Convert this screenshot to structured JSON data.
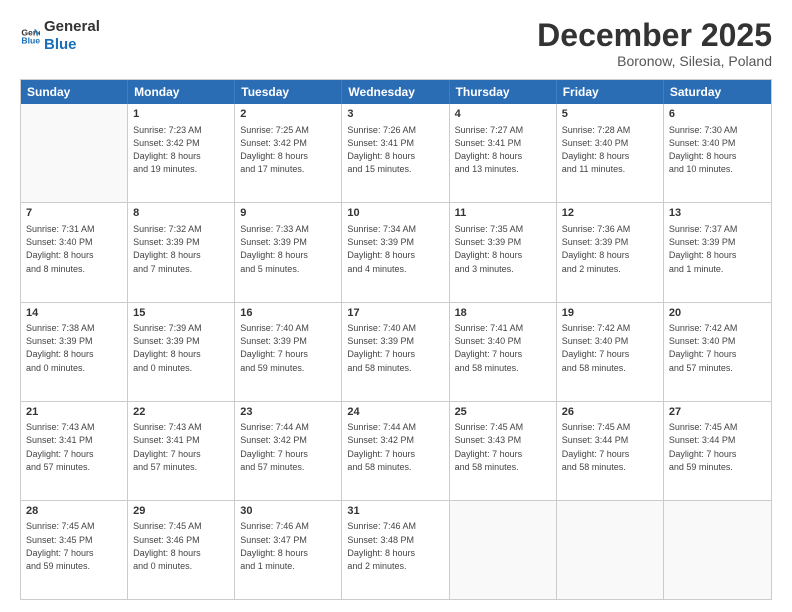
{
  "logo": {
    "line1": "General",
    "line2": "Blue"
  },
  "header": {
    "month": "December 2025",
    "location": "Boronow, Silesia, Poland"
  },
  "weekdays": [
    "Sunday",
    "Monday",
    "Tuesday",
    "Wednesday",
    "Thursday",
    "Friday",
    "Saturday"
  ],
  "weeks": [
    [
      {
        "day": "",
        "text": ""
      },
      {
        "day": "1",
        "text": "Sunrise: 7:23 AM\nSunset: 3:42 PM\nDaylight: 8 hours\nand 19 minutes."
      },
      {
        "day": "2",
        "text": "Sunrise: 7:25 AM\nSunset: 3:42 PM\nDaylight: 8 hours\nand 17 minutes."
      },
      {
        "day": "3",
        "text": "Sunrise: 7:26 AM\nSunset: 3:41 PM\nDaylight: 8 hours\nand 15 minutes."
      },
      {
        "day": "4",
        "text": "Sunrise: 7:27 AM\nSunset: 3:41 PM\nDaylight: 8 hours\nand 13 minutes."
      },
      {
        "day": "5",
        "text": "Sunrise: 7:28 AM\nSunset: 3:40 PM\nDaylight: 8 hours\nand 11 minutes."
      },
      {
        "day": "6",
        "text": "Sunrise: 7:30 AM\nSunset: 3:40 PM\nDaylight: 8 hours\nand 10 minutes."
      }
    ],
    [
      {
        "day": "7",
        "text": "Sunrise: 7:31 AM\nSunset: 3:40 PM\nDaylight: 8 hours\nand 8 minutes."
      },
      {
        "day": "8",
        "text": "Sunrise: 7:32 AM\nSunset: 3:39 PM\nDaylight: 8 hours\nand 7 minutes."
      },
      {
        "day": "9",
        "text": "Sunrise: 7:33 AM\nSunset: 3:39 PM\nDaylight: 8 hours\nand 5 minutes."
      },
      {
        "day": "10",
        "text": "Sunrise: 7:34 AM\nSunset: 3:39 PM\nDaylight: 8 hours\nand 4 minutes."
      },
      {
        "day": "11",
        "text": "Sunrise: 7:35 AM\nSunset: 3:39 PM\nDaylight: 8 hours\nand 3 minutes."
      },
      {
        "day": "12",
        "text": "Sunrise: 7:36 AM\nSunset: 3:39 PM\nDaylight: 8 hours\nand 2 minutes."
      },
      {
        "day": "13",
        "text": "Sunrise: 7:37 AM\nSunset: 3:39 PM\nDaylight: 8 hours\nand 1 minute."
      }
    ],
    [
      {
        "day": "14",
        "text": "Sunrise: 7:38 AM\nSunset: 3:39 PM\nDaylight: 8 hours\nand 0 minutes."
      },
      {
        "day": "15",
        "text": "Sunrise: 7:39 AM\nSunset: 3:39 PM\nDaylight: 8 hours\nand 0 minutes."
      },
      {
        "day": "16",
        "text": "Sunrise: 7:40 AM\nSunset: 3:39 PM\nDaylight: 7 hours\nand 59 minutes."
      },
      {
        "day": "17",
        "text": "Sunrise: 7:40 AM\nSunset: 3:39 PM\nDaylight: 7 hours\nand 58 minutes."
      },
      {
        "day": "18",
        "text": "Sunrise: 7:41 AM\nSunset: 3:40 PM\nDaylight: 7 hours\nand 58 minutes."
      },
      {
        "day": "19",
        "text": "Sunrise: 7:42 AM\nSunset: 3:40 PM\nDaylight: 7 hours\nand 58 minutes."
      },
      {
        "day": "20",
        "text": "Sunrise: 7:42 AM\nSunset: 3:40 PM\nDaylight: 7 hours\nand 57 minutes."
      }
    ],
    [
      {
        "day": "21",
        "text": "Sunrise: 7:43 AM\nSunset: 3:41 PM\nDaylight: 7 hours\nand 57 minutes."
      },
      {
        "day": "22",
        "text": "Sunrise: 7:43 AM\nSunset: 3:41 PM\nDaylight: 7 hours\nand 57 minutes."
      },
      {
        "day": "23",
        "text": "Sunrise: 7:44 AM\nSunset: 3:42 PM\nDaylight: 7 hours\nand 57 minutes."
      },
      {
        "day": "24",
        "text": "Sunrise: 7:44 AM\nSunset: 3:42 PM\nDaylight: 7 hours\nand 58 minutes."
      },
      {
        "day": "25",
        "text": "Sunrise: 7:45 AM\nSunset: 3:43 PM\nDaylight: 7 hours\nand 58 minutes."
      },
      {
        "day": "26",
        "text": "Sunrise: 7:45 AM\nSunset: 3:44 PM\nDaylight: 7 hours\nand 58 minutes."
      },
      {
        "day": "27",
        "text": "Sunrise: 7:45 AM\nSunset: 3:44 PM\nDaylight: 7 hours\nand 59 minutes."
      }
    ],
    [
      {
        "day": "28",
        "text": "Sunrise: 7:45 AM\nSunset: 3:45 PM\nDaylight: 7 hours\nand 59 minutes."
      },
      {
        "day": "29",
        "text": "Sunrise: 7:45 AM\nSunset: 3:46 PM\nDaylight: 8 hours\nand 0 minutes."
      },
      {
        "day": "30",
        "text": "Sunrise: 7:46 AM\nSunset: 3:47 PM\nDaylight: 8 hours\nand 1 minute."
      },
      {
        "day": "31",
        "text": "Sunrise: 7:46 AM\nSunset: 3:48 PM\nDaylight: 8 hours\nand 2 minutes."
      },
      {
        "day": "",
        "text": ""
      },
      {
        "day": "",
        "text": ""
      },
      {
        "day": "",
        "text": ""
      }
    ]
  ]
}
